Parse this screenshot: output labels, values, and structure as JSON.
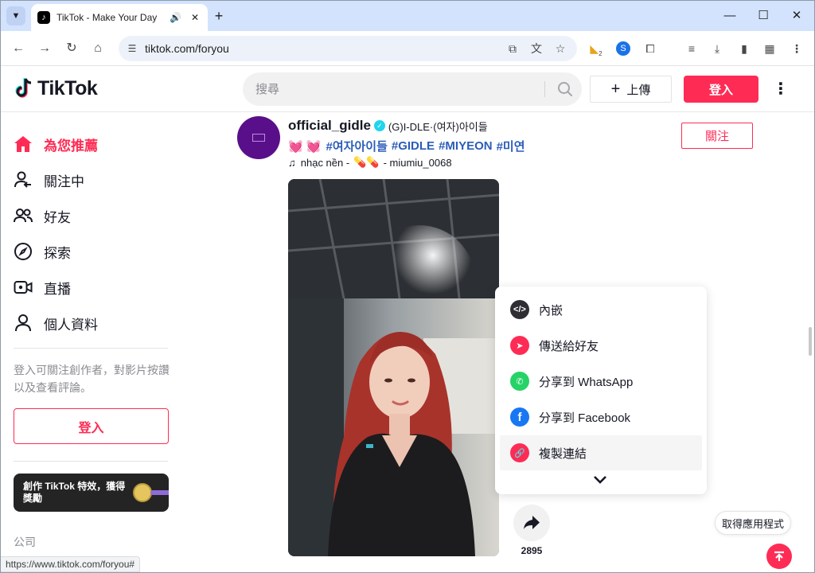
{
  "browser": {
    "tab_title": "TikTok - Make Your Day",
    "url": "tiktok.com/foryou",
    "status_url": "https://www.tiktok.com/foryou#",
    "extension_badge": "2"
  },
  "header": {
    "logo_text": "TikTok",
    "search_placeholder": "搜尋",
    "upload_label": "上傳",
    "login_label": "登入"
  },
  "sidebar": {
    "items": [
      {
        "label": "為您推薦",
        "icon": "home-icon"
      },
      {
        "label": "關注中",
        "icon": "following-icon"
      },
      {
        "label": "好友",
        "icon": "friends-icon"
      },
      {
        "label": "探索",
        "icon": "compass-icon"
      },
      {
        "label": "直播",
        "icon": "live-icon"
      },
      {
        "label": "個人資料",
        "icon": "profile-icon"
      }
    ],
    "login_hint": "登入可關注創作者，對影片按讚以及查看評論。",
    "login_button": "登入",
    "effect_banner": "創作 TikTok 特效，獲得獎勵",
    "company": "公司"
  },
  "post": {
    "author": "official_gidle",
    "nickname": "(G)I-DLE·(여자)아이들",
    "hearts": "💓 💓",
    "hashtags": [
      "#여자아이들",
      "#GIDLE",
      "#MIYEON",
      "#미연"
    ],
    "music_label": "nhạc nền - ",
    "music_author": "- miumiu_0068",
    "follow_label": "關注",
    "share_count": "2895"
  },
  "share_menu": {
    "items": [
      {
        "label": "內嵌",
        "icon": "embed-icon",
        "color": "#2f2f33"
      },
      {
        "label": "傳送給好友",
        "icon": "send-icon",
        "color": "#fe2c55"
      },
      {
        "label": "分享到 WhatsApp",
        "icon": "whatsapp-icon",
        "color": "#25d366"
      },
      {
        "label": "分享到 Facebook",
        "icon": "facebook-icon",
        "color": "#1877f2"
      },
      {
        "label": "複製連結",
        "icon": "link-icon",
        "color": "#fe2c55"
      }
    ]
  },
  "get_app_label": "取得應用程式",
  "colors": {
    "accent": "#fe2c55",
    "hashtag": "#2b5db9"
  }
}
